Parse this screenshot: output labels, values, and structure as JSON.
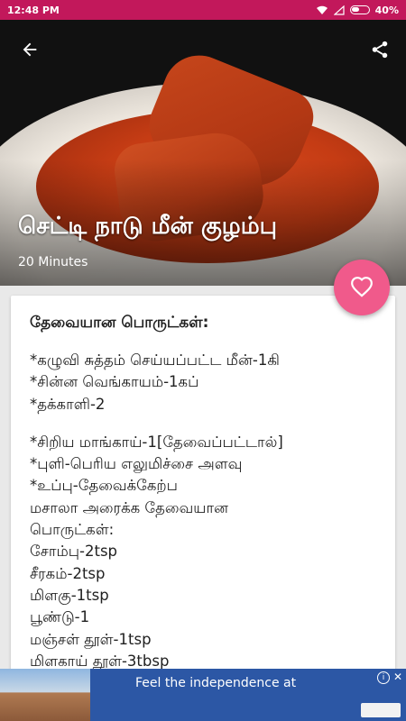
{
  "status_bar": {
    "time": "12:48 PM",
    "battery": "40%"
  },
  "recipe": {
    "title": "செட்டி நாடு மீன் குழம்பு",
    "duration": "20 Minutes"
  },
  "content": {
    "heading": "தேவையான பொருட்கள்:",
    "ingredients": [
      "*கழுவி சுத்தம் செய்யப்பட்ட மீன்-1கி",
      "*சின்ன வெங்காயம்-1கப்",
      "*தக்காளி-2",
      "",
      "*சிறிய மாங்காய்-1[தேவைப்பட்டால்]",
      "*புளி-பெரிய எலுமிச்சை அளவு",
      "*உப்பு-தேவைக்கேற்ப",
      "மசாலா அரைக்க தேவையான",
      "பொருட்கள்:",
      "சோம்பு-2tsp",
      "சீரகம்-2tsp",
      "மிளகு-1tsp",
      "பூண்டு-1",
      "மஞ்சள் தூள்-1tsp",
      "மிளகாய் தூள்-3tbsp"
    ]
  },
  "ad": {
    "text": "Feel the independence at"
  },
  "colors": {
    "status_bar": "#c2185b",
    "fab": "#f05a8b",
    "ad_bg": "#2c57a5"
  },
  "icons": {
    "back": "arrow-left",
    "share": "share",
    "favorite": "heart-outline"
  }
}
